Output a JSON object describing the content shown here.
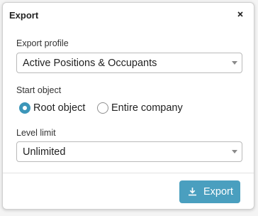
{
  "dialog": {
    "title": "Export",
    "close_icon": "close-icon"
  },
  "export_profile": {
    "label": "Export profile",
    "selected": "Active Positions & Occupants"
  },
  "start_object": {
    "label": "Start object",
    "options": [
      {
        "label": "Root object",
        "checked": true
      },
      {
        "label": "Entire company",
        "checked": false
      }
    ]
  },
  "level_limit": {
    "label": "Level limit",
    "selected": "Unlimited"
  },
  "footer": {
    "export_label": "Export",
    "export_icon": "download-icon"
  },
  "colors": {
    "accent": "#4a9fbf",
    "radio_checked": "#3c96b9"
  }
}
